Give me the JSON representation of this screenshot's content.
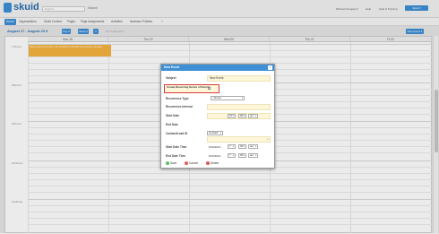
{
  "app": {
    "name": "skuid"
  },
  "header": {
    "search_placeholder": "Search...",
    "search_link": "Search",
    "user_menu": "Michael Kruepke ▾",
    "help_link": "Help",
    "training_link": "Help & Training",
    "setup_button": "Skuid ▾"
  },
  "nav": {
    "tabs": [
      {
        "label": "Home",
        "active": true
      },
      {
        "label": "Organizations"
      },
      {
        "label": "Skuid Context"
      },
      {
        "label": "Pages"
      },
      {
        "label": "Page Assignments"
      },
      {
        "label": "Activities"
      },
      {
        "label": "Assessor Policies"
      },
      {
        "label": "+"
      }
    ]
  },
  "calendar": {
    "title": "August 17 - August 23 ▾",
    "btn_day": "Day ▾",
    "btn_week": "Week ▾",
    "go_today": "Go To Aug 19 ▾",
    "btn_new_event": "New Event ▾",
    "days": [
      "Mon 18",
      "Tue 19",
      "Wed 20",
      "Thu 21",
      "Fri 22"
    ],
    "times": [
      "7:00 am",
      "8:00 am",
      "9:00 am",
      "10:00 am",
      "11:00 am"
    ],
    "event_text": "Some event text in the 7 am timeslot on Monday for example purposes"
  },
  "modal": {
    "title": "New Event",
    "fields": {
      "subject_label": "Subject",
      "subject_value": "New Event",
      "recurring_label": "Create Recurring Series of Events",
      "recurrence_type_label": "Recurrence Type",
      "recurrence_type_value": "--None--",
      "recurrence_interval_label": "Recurrence Interval",
      "start_date_label": "Start Date",
      "start_hour": "10",
      "start_min": "00",
      "start_ampm": "pm",
      "end_date_label": "End Date",
      "contact_label": "Contact/Lead ID",
      "contact_type": "Contact",
      "start_datetime_label": "Start Date Time",
      "start_datetime_date": "8/19/2014",
      "start_datetime_hour": "7",
      "start_datetime_min": "00",
      "start_datetime_ampm": "am",
      "end_datetime_label": "End Date Time",
      "end_datetime_date": "8/19/2014",
      "end_datetime_hour": "7",
      "end_datetime_min": "00",
      "end_datetime_ampm": "am"
    },
    "save_label": "Save",
    "cancel_label": "Cancel",
    "delete_label": "Delete"
  },
  "colors": {
    "accent": "#3d8fd6",
    "event": "#f5b33e",
    "highlight": "#d93b3b",
    "field_bg": "#fdf6d8"
  }
}
